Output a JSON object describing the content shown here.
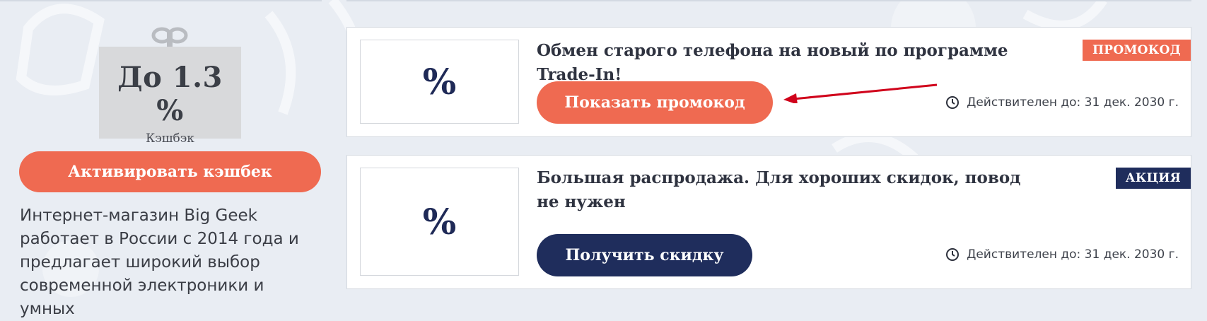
{
  "store": {
    "cashback_value": "До 1.3 %",
    "cashback_caption": "Кэшбэк",
    "activate_label": "Активировать кэшбек",
    "description": "Интернет-магазин Big Geek работает в России с 2014 года и предлагает широкий выбор современной электроники и умных"
  },
  "offers": [
    {
      "thumb_symbol": "%",
      "title": "Обмен старого телефона на новый по программе Trade-In!",
      "badge": "ПРОМОКОД",
      "button_label": "Показать промокод",
      "validity": "Действителен до: 31 дек. 2030 г."
    },
    {
      "thumb_symbol": "%",
      "title": "Большая распродажа. Для хороших скидок, повод не нужен",
      "badge": "АКЦИЯ",
      "button_label": "Получить скидку",
      "validity": "Действителен до: 31 дек. 2030 г."
    }
  ],
  "colors": {
    "accent_orange": "#ef6a51",
    "accent_navy": "#1f2d5c",
    "background": "#e9edf3",
    "annotation_arrow": "#d0021b"
  },
  "icons": {
    "validity": "clock-icon",
    "gift": "gift-bow-icon"
  }
}
